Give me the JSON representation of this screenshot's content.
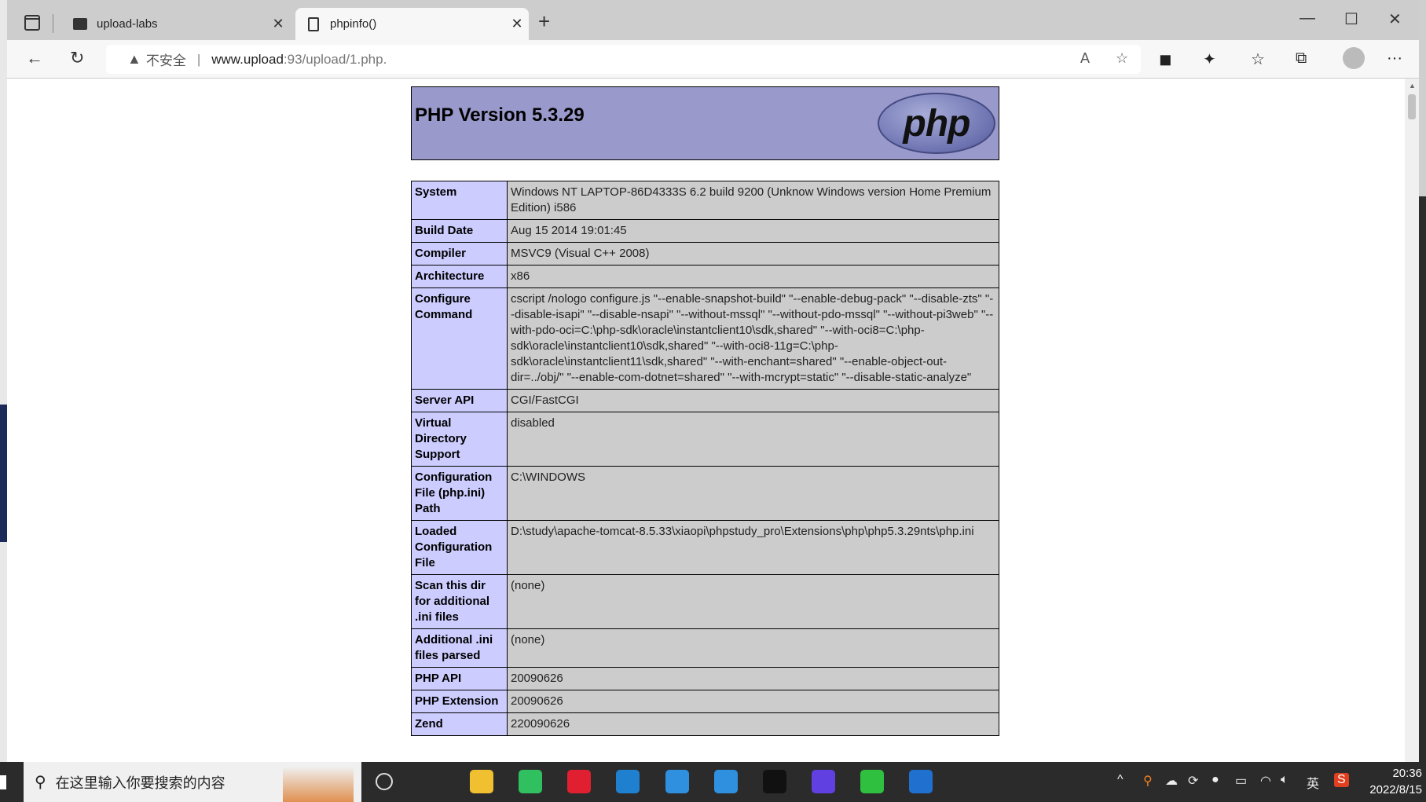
{
  "browser": {
    "tabs": [
      {
        "label": "upload-labs",
        "icon": "folder-icon",
        "active": false
      },
      {
        "label": "phpinfo()",
        "icon": "page-icon",
        "active": true
      }
    ],
    "address": {
      "warning": "不安全",
      "host": "www.upload",
      "rest": ":93/upload/1.php."
    }
  },
  "page": {
    "title": "PHP Version 5.3.29",
    "logo_text": "php",
    "rows": [
      {
        "k": "System",
        "v": "Windows NT LAPTOP-86D4333S 6.2 build 9200 (Unknow Windows version Home Premium Edition) i586"
      },
      {
        "k": "Build Date",
        "v": "Aug 15 2014 19:01:45"
      },
      {
        "k": "Compiler",
        "v": "MSVC9 (Visual C++ 2008)"
      },
      {
        "k": "Architecture",
        "v": "x86"
      },
      {
        "k": "Configure Command",
        "v": "cscript /nologo configure.js \"--enable-snapshot-build\" \"--enable-debug-pack\" \"--disable-zts\" \"--disable-isapi\" \"--disable-nsapi\" \"--without-mssql\" \"--without-pdo-mssql\" \"--without-pi3web\" \"--with-pdo-oci=C:\\php-sdk\\oracle\\instantclient10\\sdk,shared\" \"--with-oci8=C:\\php-sdk\\oracle\\instantclient10\\sdk,shared\" \"--with-oci8-11g=C:\\php-sdk\\oracle\\instantclient11\\sdk,shared\" \"--with-enchant=shared\" \"--enable-object-out-dir=../obj/\" \"--enable-com-dotnet=shared\" \"--with-mcrypt=static\" \"--disable-static-analyze\""
      },
      {
        "k": "Server API",
        "v": "CGI/FastCGI"
      },
      {
        "k": "Virtual Directory Support",
        "v": "disabled"
      },
      {
        "k": "Configuration File (php.ini) Path",
        "v": "C:\\WINDOWS"
      },
      {
        "k": "Loaded Configuration File",
        "v": "D:\\study\\apache-tomcat-8.5.33\\xiaopi\\phpstudy_pro\\Extensions\\php\\php5.3.29nts\\php.ini"
      },
      {
        "k": "Scan this dir for additional .ini files",
        "v": "(none)"
      },
      {
        "k": "Additional .ini files parsed",
        "v": "(none)"
      },
      {
        "k": "PHP API",
        "v": "20090626"
      },
      {
        "k": "PHP Extension",
        "v": "20090626"
      },
      {
        "k": "Zend",
        "v": "220090626"
      }
    ],
    "colors": {
      "header": "#9999cc",
      "key": "#ccccff",
      "value": "#cccccc"
    }
  },
  "taskbar": {
    "search_placeholder": "在这里输入你要搜索的内容",
    "ime": "英",
    "time": "20:36",
    "date": "2022/8/15",
    "apps": [
      "task-view",
      "file-explorer",
      "video-player",
      "netease-music",
      "edge",
      "browser-q1",
      "browser-q2",
      "terminal",
      "app-bolt",
      "wechat",
      "notepad"
    ]
  }
}
